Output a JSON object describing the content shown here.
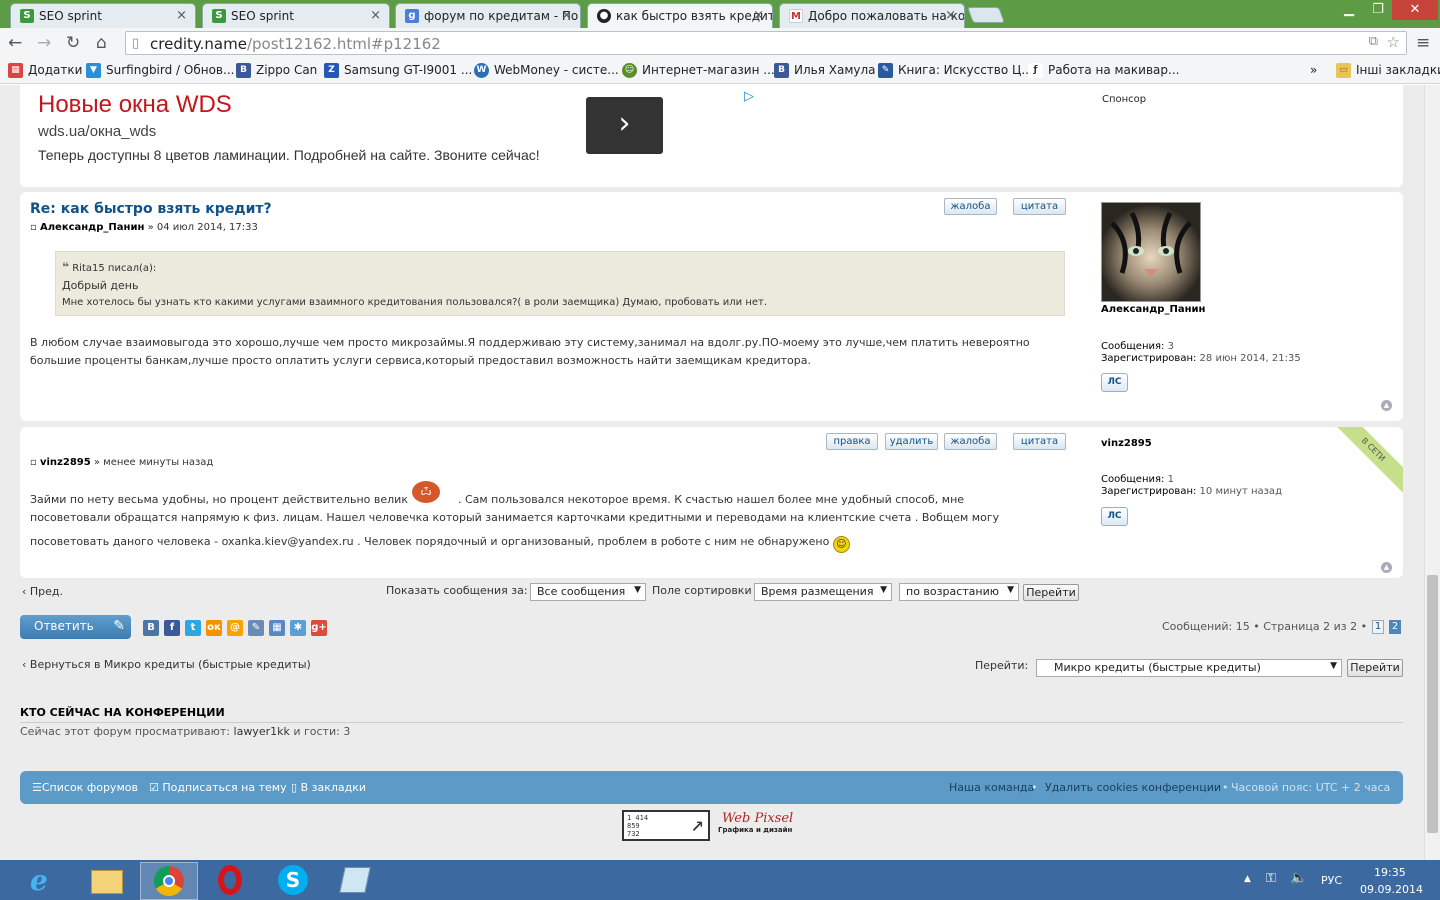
{
  "browser": {
    "tabs": [
      {
        "title": "SEO sprint",
        "icon": "seosprint-icon"
      },
      {
        "title": "SEO sprint",
        "icon": "seosprint-icon"
      },
      {
        "title": "форум по кредитам - По",
        "icon": "google-icon"
      },
      {
        "title": "как быстро взять кредит",
        "icon": "site-icon"
      },
      {
        "title": "Добро пожаловать на ко",
        "icon": "gmail-icon"
      }
    ],
    "url_host": "credity.name",
    "url_path": "/post12162.html#p12162",
    "bookmarks": [
      "Додатки",
      "Surfingbird / Обнов...",
      "Zippo Can",
      "Samsung GT-I9001 ...",
      "WebMoney - систе...",
      "Интернет-магазин ...",
      "Илья Хамула",
      "Книга: Искусство Ц...",
      "Работа на макивар..."
    ],
    "bookmarks_more": "»",
    "other_bookmarks": "Інші закладки"
  },
  "ad": {
    "title": "Новые окна WDS",
    "url": "wds.ua/окна_wds",
    "description": "Теперь доступны 8 цветов ламинации. Подробней на сайте. Звоните сейчас!",
    "sponsor": "Спонсор"
  },
  "post1": {
    "title": "Re: как быстро взять кредит?",
    "author": "Александр_Панин",
    "date": "» 04 июл 2014, 17:33",
    "buttons": [
      "жалоба",
      "цитата"
    ],
    "quote_author": "Rita15 писал(а):",
    "quote_lines": [
      "Добрый день",
      "Мне хотелось бы узнать кто какими услугами взаимного кредитования пользовался?( в роли заемщика) Думаю, пробовать или нет."
    ],
    "body_lines": [
      "В любом случае взаимовыгода это хорошо,лучше чем просто микрозаймы.Я поддерживаю эту систему,занимал на вдолг.ру.ПО-моему это лучше,чем платить невероятно",
      "большие проценты банкам,лучше просто оплатить услуги сервиса,который предоставил возможность найти заемщикам кредитора."
    ],
    "profile": {
      "name": "Александр_Панин",
      "posts_label": "Сообщения:",
      "posts": "3",
      "reg_label": "Зарегистрирован:",
      "reg": "28 июн 2014, 21:35",
      "pm": "ЛС"
    }
  },
  "post2": {
    "author": "vinz2895",
    "date": "» менее минуты назад",
    "buttons": [
      "правка",
      "удалить",
      "жалоба",
      "цитата"
    ],
    "body_lines": [
      "Займи по нету весьма удобны, но процент действительно велик",
      ". Сам пользовался некоторое время. К счастью нашел более мне удобный способ, мне",
      "посоветовали обращатся напрямую к физ. лицам. Нашел человечка который занимается карточками кредитными и переводами на клиентские счета . Вобщем могу",
      "посоветовать даного человека - oxanka.kiev@yandex.ru . Человек порядочный и организованый, проблем в роботе с ним не обнаружено"
    ],
    "profile": {
      "name": "vinz2895",
      "online": "В СЕТИ",
      "posts_label": "Сообщения:",
      "posts": "1",
      "reg_label": "Зарегистрирован:",
      "reg": "10 минут назад",
      "pm": "ЛС"
    }
  },
  "controls": {
    "prev": "Пред.",
    "show_label": "Показать сообщения за:",
    "show_value": "Все сообщения",
    "sort_label": "Поле сортировки",
    "sort_value": "Время размещения",
    "order_value": "по возрастанию",
    "go": "Перейти",
    "reply": "Ответить",
    "pagination_text": "Сообщений: 15 • Страница 2 из 2 •",
    "pages": [
      "1",
      "2"
    ],
    "back": "Вернуться в Микро кредиты (быстрые кредиты)",
    "jump_label": "Перейти:",
    "jump_value": "Микро кредиты (быстрые кредиты)",
    "jump_go": "Перейти"
  },
  "online": {
    "heading": "КТО СЕЙЧАС НА КОНФЕРЕНЦИИ",
    "text_prefix": "Сейчас этот форум просматривают:",
    "user": "lawyer1kk",
    "text_suffix": "и гости: 3"
  },
  "footer": {
    "forums": "Список форумов",
    "subscribe": "Подписаться на тему",
    "bookmarks": "В закладки",
    "team": "Наша команда",
    "cookies": "Удалить cookies конференции",
    "timezone": "Часовой пояс: UTC + 2 часа",
    "counter_lines": [
      "1 414",
      "859",
      "732"
    ],
    "webpixel": "Web Pixsel",
    "webpixel_sub": "Графика и дизайн"
  },
  "taskbar": {
    "lang": "РУС",
    "time": "19:35",
    "date": "09.09.2014"
  },
  "colors": {
    "link": "#105289",
    "chrome_frame": "#5d9c45",
    "footer": "#5c9bc8",
    "taskbar": "#3c6aa0"
  }
}
